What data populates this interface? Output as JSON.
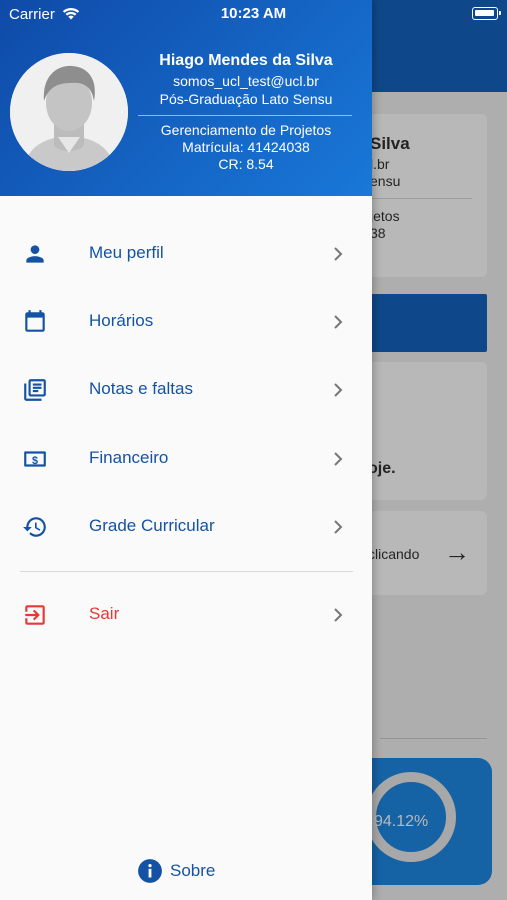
{
  "status_bar": {
    "carrier": "Carrier",
    "time": "10:23 AM"
  },
  "profile": {
    "name": "Hiago Mendes da Silva",
    "email": "somos_ucl_test@ucl.br",
    "program": "Pós-Graduação Lato Sensu",
    "course": "Gerenciamento de Projetos",
    "matricula": "Matrícula: 41424038",
    "cr": "CR: 8.54"
  },
  "menu": {
    "items": [
      {
        "label": "Meu perfil",
        "icon": "person-icon"
      },
      {
        "label": "Horários",
        "icon": "calendar-icon"
      },
      {
        "label": "Notas e faltas",
        "icon": "notes-icon"
      },
      {
        "label": "Financeiro",
        "icon": "money-icon"
      },
      {
        "label": "Grade Curricular",
        "icon": "history-icon"
      }
    ],
    "logout": {
      "label": "Sair",
      "icon": "logout-icon"
    }
  },
  "about": {
    "label": "Sobre"
  },
  "background": {
    "card_name": "Silva",
    "card_email": "l.br",
    "card_program": "ensu",
    "card_course": "jetos",
    "card_matricula": "38",
    "card_text": "oje.",
    "card_link": "clicando",
    "progress_label": "94.12%"
  },
  "colors": {
    "primary": "#1453a4",
    "header_start": "#0f4aa8",
    "header_end": "#1978d8",
    "danger": "#e53935"
  }
}
